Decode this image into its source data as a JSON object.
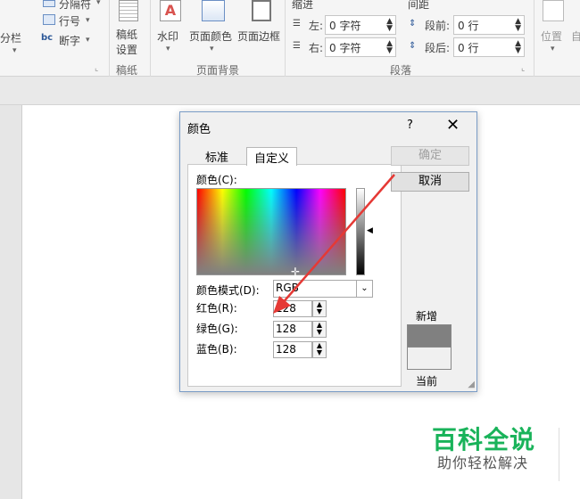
{
  "ribbon": {
    "breaks_label": "分隔符",
    "columns_label": "分栏",
    "line_numbers_label": "行号",
    "hyphenation_label": "断字",
    "manuscript_label": "稿纸\n设置",
    "manuscript_label_line1": "稿纸",
    "manuscript_label_line2": "设置",
    "watermark_label": "水印",
    "page_color_label": "页面颜色",
    "page_borders_label": "页面边框",
    "indent_label": "缩进",
    "spacing_label": "间距",
    "left_label": "左:",
    "right_label": "右:",
    "left_value": "0 字符",
    "right_value": "0 字符",
    "before_label": "段前:",
    "after_label": "段后:",
    "before_value": "0 行",
    "after_value": "0 行",
    "position_label": "位置",
    "position_label_2": "自",
    "groups": {
      "manuscript": "稿纸",
      "page_background": "页面背景",
      "paragraph": "段落"
    }
  },
  "dialog": {
    "title": "颜色",
    "help": "?",
    "close": "✕",
    "tab_standard": "标准",
    "tab_custom": "自定义",
    "ok": "确定",
    "cancel": "取消",
    "colors_label": "颜色(C):",
    "mode_label": "颜色模式(D):",
    "mode_value": "RGB",
    "red_label": "红色(R):",
    "green_label": "绿色(G):",
    "blue_label": "蓝色(B):",
    "red_value": "128",
    "green_value": "128",
    "blue_value": "128",
    "new_label": "新增",
    "current_label": "当前",
    "new_color": "#808080",
    "current_color": "#f0f0f0"
  },
  "watermark": {
    "title": "百科全说",
    "subtitle": "助你轻松解决"
  },
  "annotation": {
    "arrow_color": "#e53935"
  }
}
